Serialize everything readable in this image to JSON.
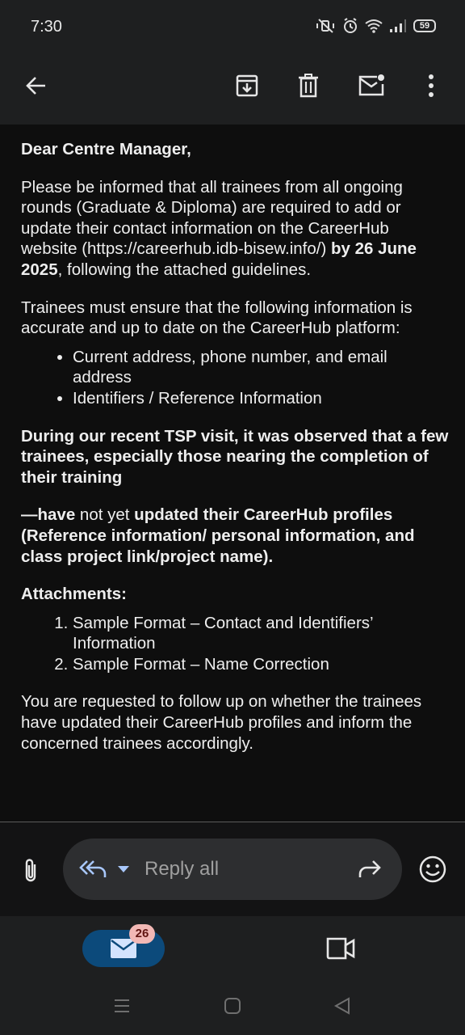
{
  "status_bar": {
    "time": "7:30",
    "battery": "59",
    "icons": [
      "mute-vibrate-icon",
      "alarm-icon",
      "wifi-icon",
      "signal-icon",
      "battery-icon"
    ]
  },
  "toolbar": {
    "icons": [
      "back-arrow-icon",
      "archive-icon",
      "delete-icon",
      "mark-unread-icon",
      "more-vert-icon"
    ]
  },
  "email": {
    "greeting": "Dear Centre Manager,",
    "para1_text": "Please be informed that all trainees from all ongoing rounds (Graduate & Diploma) are required to add or update their contact information on the CareerHub website (https://careerhub.idb-bisew.info/) ",
    "para1_bold": "by 26 June 2025",
    "para1_end": ", following the attached guidelines.",
    "para2": "Trainees must ensure that the following information is accurate and up to date on the CareerHub platform:",
    "bullets": [
      "Current address, phone number, and email address",
      "Identifiers / Reference Information"
    ],
    "para3": "During our recent TSP visit, it was observed that a few trainees, especially those nearing the completion of their training",
    "para4_bold1": "—have",
    "para4_normal": " not yet ",
    "para4_bold2": "updated their CareerHub profiles (Reference information/ personal information, and class project link/project name).",
    "attachments_heading": "Attachments:",
    "attachments": [
      "Sample Format – Contact and Identifiers’ Information",
      "Sample Format – Name Correction"
    ],
    "para5": "You are requested to follow up on whether the trainees have updated their CareerHub profiles and inform the concerned trainees accordingly."
  },
  "reply_bar": {
    "label": "Reply all",
    "icons": [
      "attach-icon",
      "reply-all-icon",
      "forward-icon",
      "emoji-icon"
    ]
  },
  "bottom_nav": {
    "mail_badge": "26",
    "icons": [
      "mail-icon",
      "meet-video-icon"
    ]
  },
  "colors": {
    "background": "#0e0e0e",
    "bar": "#1e1f20",
    "accent": "#a8c7fa",
    "mail_tab": "#0c4a7b",
    "badge": "#f2b8b5"
  }
}
